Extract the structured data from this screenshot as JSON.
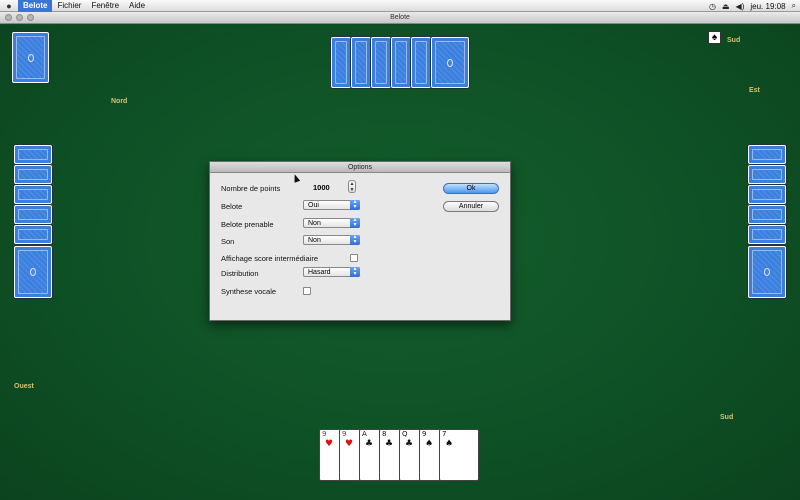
{
  "menubar": {
    "app": "Belote",
    "items": [
      "Fichier",
      "Fenêtre",
      "Aide"
    ],
    "clock": "jeu. 19:08"
  },
  "window": {
    "title": "Belote"
  },
  "players": {
    "north": "Nord",
    "south": "Sud",
    "east": "Est",
    "west": "Ouest",
    "trump_owner": "Sud"
  },
  "trump": {
    "suit": "♠"
  },
  "hand": [
    {
      "rank": "9",
      "suit": "♥",
      "color": "red"
    },
    {
      "rank": "9",
      "suit": "♥",
      "color": "red"
    },
    {
      "rank": "A",
      "suit": "♣",
      "color": "blk"
    },
    {
      "rank": "8",
      "suit": "♣",
      "color": "blk"
    },
    {
      "rank": "Q",
      "suit": "♣",
      "color": "blk"
    },
    {
      "rank": "9",
      "suit": "♠",
      "color": "blk"
    },
    {
      "rank": "7",
      "suit": "♠",
      "color": "blk"
    }
  ],
  "dialog": {
    "title": "Options",
    "points_label": "Nombre de points",
    "points_value": "1000",
    "belote_label": "Belote",
    "belote_value": "Oui",
    "belote_prenable_label": "Belote prenable",
    "belote_prenable_value": "Non",
    "son_label": "Son",
    "son_value": "Non",
    "affichage_label": "Affichage score intermédiaire",
    "distribution_label": "Distribution",
    "distribution_value": "Hasard",
    "synthese_label": "Synthese vocale",
    "ok_label": "Ok",
    "cancel_label": "Annuler"
  },
  "colors": {
    "felt": "#0f5126",
    "card_back": "#3a7fe0",
    "accent": "#3875d7"
  }
}
